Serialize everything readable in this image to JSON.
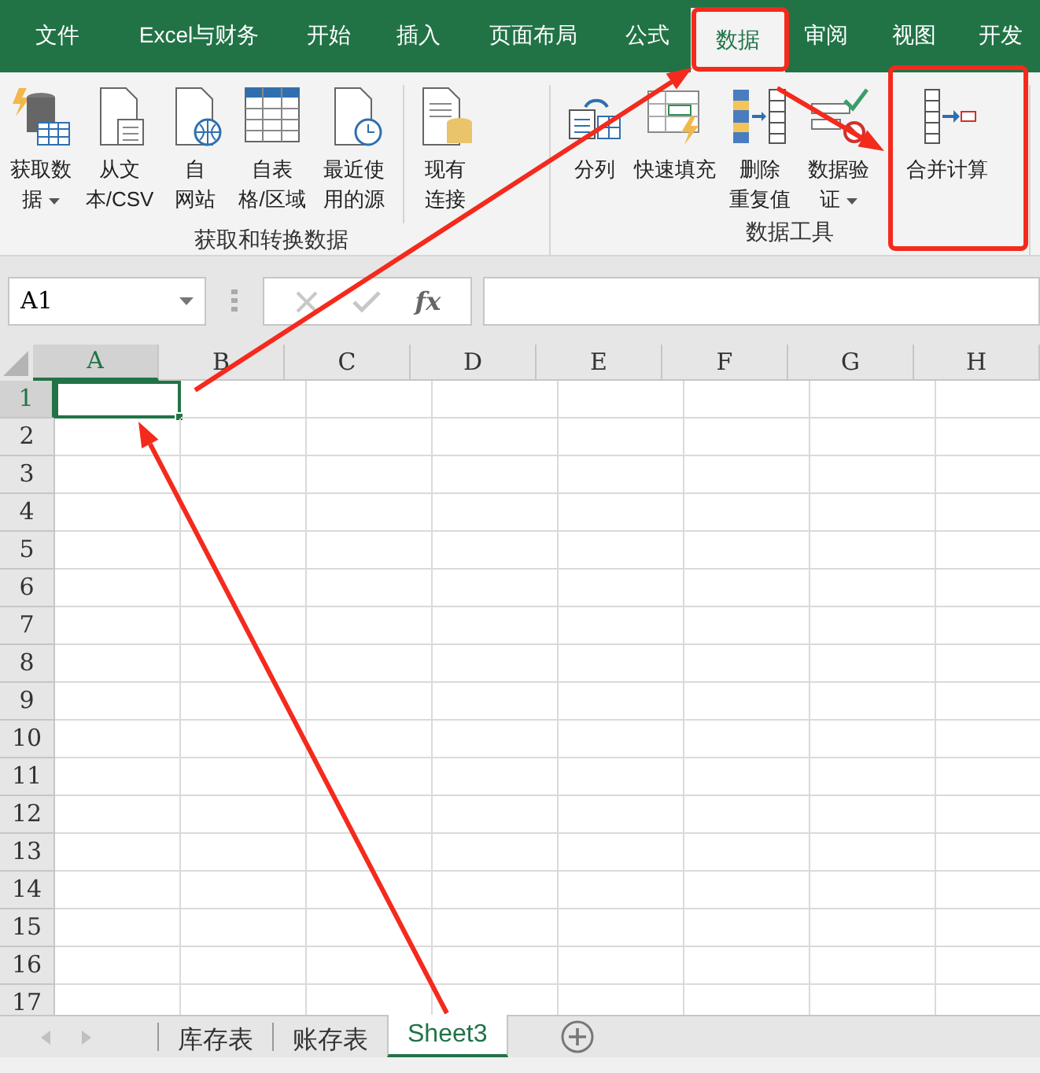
{
  "menu_tabs": [
    {
      "label": "文件",
      "selected": false
    },
    {
      "label": "Excel与财务",
      "selected": false
    },
    {
      "label": "开始",
      "selected": false
    },
    {
      "label": "插入",
      "selected": false
    },
    {
      "label": "页面布局",
      "selected": false
    },
    {
      "label": "公式",
      "selected": false
    },
    {
      "label": "数据",
      "selected": true
    },
    {
      "label": "审阅",
      "selected": false
    },
    {
      "label": "视图",
      "selected": false
    },
    {
      "label": "开发",
      "selected": false
    }
  ],
  "ribbon_groups": [
    {
      "label": "获取和转换数据",
      "buttons": [
        {
          "lines": [
            "获取数",
            "据"
          ],
          "dropdown": true
        },
        {
          "lines": [
            "从文",
            "本/CSV"
          ],
          "dropdown": false
        },
        {
          "lines": [
            "自",
            "网站"
          ],
          "dropdown": false
        },
        {
          "lines": [
            "自表",
            "格/区域"
          ],
          "dropdown": false
        },
        {
          "lines": [
            "最近使",
            "用的源"
          ],
          "dropdown": false
        },
        {
          "lines": [
            "现有",
            "连接"
          ],
          "dropdown": false
        }
      ]
    },
    {
      "label": "数据工具",
      "buttons": [
        {
          "lines": [
            "分列"
          ],
          "dropdown": false
        },
        {
          "lines": [
            "快速填充"
          ],
          "dropdown": false
        },
        {
          "lines": [
            "删除",
            "重复值"
          ],
          "dropdown": false
        },
        {
          "lines": [
            "数据验",
            "证"
          ],
          "dropdown": true
        },
        {
          "lines": [
            "合并计算"
          ],
          "dropdown": false
        }
      ]
    }
  ],
  "name_box": "A1",
  "formula_function_label": "fx",
  "columns": [
    {
      "label": "A",
      "selected": true
    },
    {
      "label": "B",
      "selected": false
    },
    {
      "label": "C",
      "selected": false
    },
    {
      "label": "D",
      "selected": false
    },
    {
      "label": "E",
      "selected": false
    },
    {
      "label": "F",
      "selected": false
    },
    {
      "label": "G",
      "selected": false
    },
    {
      "label": "H",
      "selected": false
    }
  ],
  "rows": [
    {
      "label": "1",
      "selected": true
    },
    {
      "label": "2",
      "selected": false
    },
    {
      "label": "3",
      "selected": false
    },
    {
      "label": "4",
      "selected": false
    },
    {
      "label": "5",
      "selected": false
    },
    {
      "label": "6",
      "selected": false
    },
    {
      "label": "7",
      "selected": false
    },
    {
      "label": "8",
      "selected": false
    },
    {
      "label": "9",
      "selected": false
    },
    {
      "label": "10",
      "selected": false
    },
    {
      "label": "11",
      "selected": false
    },
    {
      "label": "12",
      "selected": false
    },
    {
      "label": "13",
      "selected": false
    },
    {
      "label": "14",
      "selected": false
    },
    {
      "label": "15",
      "selected": false
    },
    {
      "label": "16",
      "selected": false
    },
    {
      "label": "17",
      "selected": false
    }
  ],
  "sheet_tabs": [
    {
      "label": "库存表",
      "selected": false
    },
    {
      "label": "账存表",
      "selected": false
    },
    {
      "label": "Sheet3",
      "selected": true
    }
  ]
}
